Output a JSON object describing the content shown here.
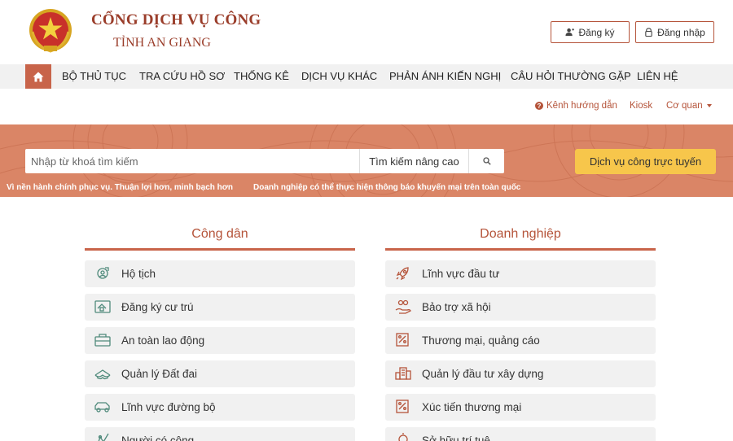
{
  "header": {
    "logo_line1": "CỔNG DỊCH VỤ CÔNG",
    "logo_line2": "TỈNH AN GIANG",
    "register_label": "Đăng ký",
    "login_label": "Đăng nhập"
  },
  "nav": {
    "items": [
      "BỘ THỦ TỤC",
      "TRA CỨU HỒ SƠ",
      "THỐNG KÊ",
      "DỊCH VỤ KHÁC",
      "PHẢN ÁNH KIẾN NGHỊ",
      "CÂU HỎI THƯỜNG GẶP",
      "LIÊN HỆ"
    ]
  },
  "sublinks": {
    "guide": "Kênh hướng dẫn",
    "kiosk": "Kiosk",
    "agency": "Cơ quan"
  },
  "search": {
    "placeholder": "Nhập từ khoá tìm kiếm",
    "advanced_label": "Tìm kiếm nâng cao",
    "online_service_label": "Dịch vụ công trực tuyến"
  },
  "marquee": {
    "item1": "Vì nền hành chính phục vụ. Thuận lợi hơn, minh bạch hơn",
    "item2": "Doanh nghiệp có thể thực hiện thông báo khuyến mại trên toàn quốc"
  },
  "citizen": {
    "title": "Công dân",
    "items": [
      {
        "label": "Hộ tịch",
        "icon": "civil-status-icon"
      },
      {
        "label": "Đăng ký cư trú",
        "icon": "residence-icon"
      },
      {
        "label": "An toàn lao động",
        "icon": "toolbox-icon"
      },
      {
        "label": "Quản lý Đất đai",
        "icon": "land-icon"
      },
      {
        "label": "Lĩnh vực đường bộ",
        "icon": "car-icon"
      },
      {
        "label": "Người có công",
        "icon": "meritorious-icon"
      }
    ]
  },
  "business": {
    "title": "Doanh nghiệp",
    "items": [
      {
        "label": "Lĩnh vực đầu tư",
        "icon": "rocket-icon"
      },
      {
        "label": "Bảo trợ xã hội",
        "icon": "social-care-icon"
      },
      {
        "label": "Thương mại, quảng cáo",
        "icon": "percent-tag-icon"
      },
      {
        "label": "Quản lý đầu tư xây dựng",
        "icon": "building-icon"
      },
      {
        "label": "Xúc tiến thương mại",
        "icon": "percent-tag-icon"
      },
      {
        "label": "Sở hữu trí tuệ",
        "icon": "intellectual-property-icon"
      }
    ]
  },
  "colors": {
    "brand": "#b5543a",
    "banner": "#da8566",
    "accent_button": "#f7c64b",
    "card_bg": "#f1f1f1"
  }
}
